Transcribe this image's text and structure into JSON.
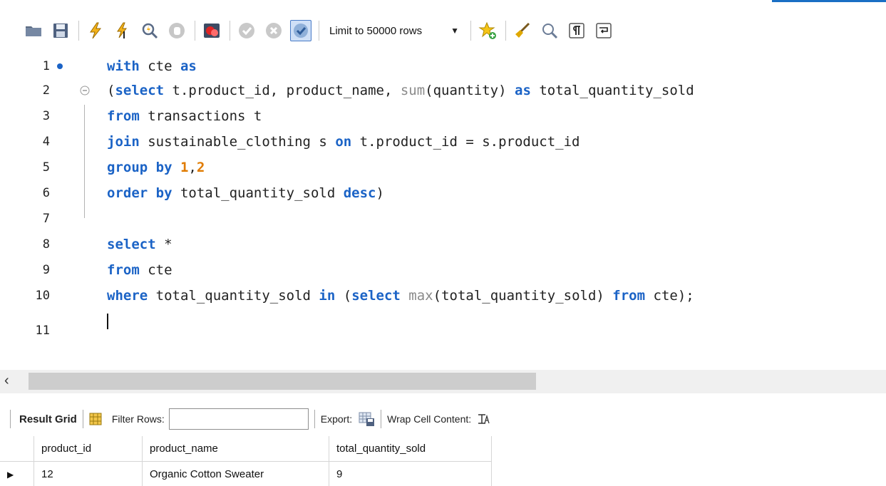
{
  "toolbar": {
    "limit_label": "Limit to 50000 rows",
    "icons": [
      "folder-icon",
      "save-icon",
      "execute-icon",
      "execute-current-icon",
      "explain-icon",
      "stop-icon",
      "stop-on-error-icon",
      "commit-icon",
      "rollback-icon",
      "autocommit-icon",
      "limit-dropdown",
      "add-snippet-icon",
      "beautify-icon",
      "find-icon",
      "invisible-chars-icon",
      "word-wrap-icon"
    ]
  },
  "editor": {
    "lines": [
      {
        "num": "1",
        "code": "with cte as"
      },
      {
        "num": "2",
        "code": "(select t.product_id, product_name, sum(quantity) as total_quantity_sold"
      },
      {
        "num": "3",
        "code": "from transactions t"
      },
      {
        "num": "4",
        "code": "join sustainable_clothing s on t.product_id = s.product_id"
      },
      {
        "num": "5",
        "code": "group by 1,2"
      },
      {
        "num": "6",
        "code": "order by total_quantity_sold desc)"
      },
      {
        "num": "7",
        "code": ""
      },
      {
        "num": "8",
        "code": "select *"
      },
      {
        "num": "9",
        "code": "from cte"
      },
      {
        "num": "10",
        "code": "where total_quantity_sold in (select max(total_quantity_sold) from cte);"
      },
      {
        "num": "11",
        "code": ""
      }
    ]
  },
  "scrollbar": {
    "left_arrow": "‹"
  },
  "results": {
    "tab_label": "Result Grid",
    "filter_label": "Filter Rows:",
    "filter_value": "",
    "export_label": "Export:",
    "wrap_label": "Wrap Cell Content:",
    "columns": [
      "product_id",
      "product_name",
      "total_quantity_sold"
    ],
    "rows": [
      [
        "12",
        "Organic Cotton Sweater",
        "9"
      ]
    ]
  },
  "colors": {
    "keyword": "#1b63c6",
    "function": "#8a8a8a",
    "number": "#e07b00",
    "accent": "#1a6fc4"
  }
}
